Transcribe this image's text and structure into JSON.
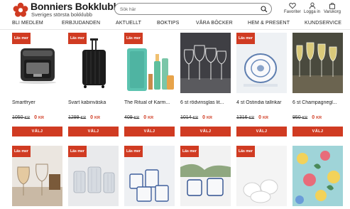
{
  "header": {
    "brand_title": "Bonniers Bokklubb",
    "brand_subtitle": "Sveriges största bokklubb",
    "search_placeholder": "Sök här",
    "favorites_label": "Favoriter",
    "login_label": "Logga in",
    "cart_label": "Varukorg"
  },
  "nav": {
    "items": [
      "BLI MEDLEM",
      "ERBJUDANDEN",
      "AKTUELLT",
      "BOKTIPS",
      "VÅRA BÖCKER",
      "HEM & PRESENT",
      "KUNDSERVICE"
    ]
  },
  "colors": {
    "accent": "#d03b22"
  },
  "products_row1": [
    {
      "badge": "Läs mer",
      "name": "Smartfryer",
      "old_price": "1050",
      "new_price": "0",
      "currency": "KR",
      "button": "VÄLJ"
    },
    {
      "badge": "Läs mer",
      "name": "Svart kabinväska",
      "old_price": "1299",
      "new_price": "0",
      "currency": "KR",
      "button": "VÄLJ"
    },
    {
      "badge": "Läs mer",
      "name": "The Ritual of Karm...",
      "old_price": "409",
      "new_price": "0",
      "currency": "KR",
      "button": "VÄLJ"
    },
    {
      "badge": "Läs mer",
      "name": "6 st rödvinsglas lit...",
      "old_price": "1014",
      "new_price": "0",
      "currency": "KR",
      "button": "VÄLJ"
    },
    {
      "badge": "Läs mer",
      "name": "4 st Ostindia tallrikar",
      "old_price": "1316",
      "new_price": "0",
      "currency": "KR",
      "button": "VÄLJ"
    },
    {
      "badge": "Läs mer",
      "name": "6 st Champagnegl...",
      "old_price": "950",
      "new_price": "0",
      "currency": "KR",
      "button": "VÄLJ"
    }
  ],
  "products_row2": [
    {
      "badge": "Läs mer"
    },
    {
      "badge": "Läs mer"
    },
    {
      "badge": "Läs mer"
    },
    {
      "badge": "Läs mer"
    },
    {
      "badge": "Läs mer"
    },
    {
      "badge": "Läs mer"
    }
  ]
}
